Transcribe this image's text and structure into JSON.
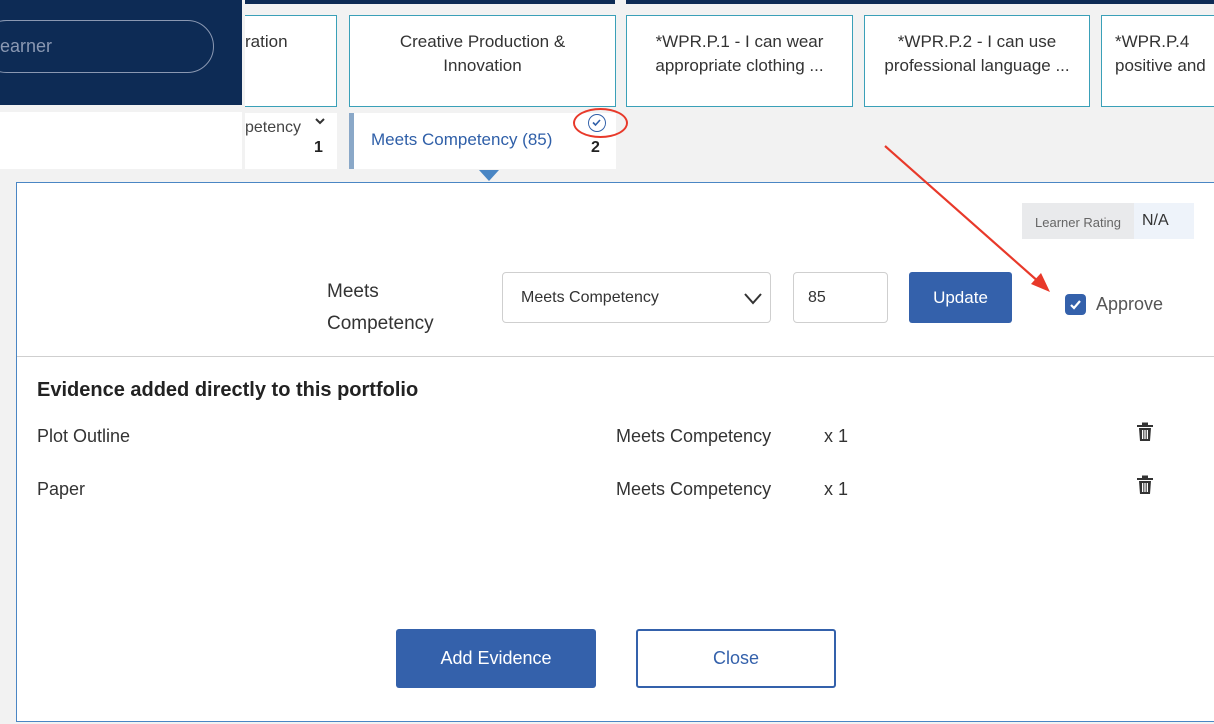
{
  "search": {
    "placeholder_fragment": "earner"
  },
  "competency_headers": [
    {
      "label_line1": "ration",
      "label_line2": ""
    },
    {
      "label_line1": "Creative Production &",
      "label_line2": "Innovation"
    },
    {
      "label_line1": "*WPR.P.1 - I can wear",
      "label_line2": "appropriate clothing ..."
    },
    {
      "label_line1": "*WPR.P.2 - I can use",
      "label_line2": "professional language ..."
    },
    {
      "label_line1": "*WPR.P.4",
      "label_line2": "positive and"
    }
  ],
  "strips": {
    "left": {
      "text": "petency",
      "count": "1",
      "chevron_icon": "chevron-down-icon"
    },
    "active": {
      "text": "Meets Competency (85)",
      "count": "2",
      "status_icon": "check-circle-icon"
    }
  },
  "panel": {
    "learner_rating": {
      "label": "Learner Rating",
      "value": "N/A"
    },
    "rating_label": "Meets Competency",
    "rating_select": {
      "value": "Meets Competency"
    },
    "score_input": {
      "value": "85"
    },
    "update_label": "Update",
    "approve": {
      "label": "Approve",
      "checked": true
    },
    "evidence_heading": "Evidence added directly to this portfolio",
    "evidence": [
      {
        "name": "Plot Outline",
        "rating": "Meets Competency",
        "count": "x 1"
      },
      {
        "name": "Paper",
        "rating": "Meets Competency",
        "count": "x 1"
      }
    ],
    "add_evidence_label": "Add Evidence",
    "close_label": "Close"
  },
  "colors": {
    "navy": "#0d2b55",
    "primary": "#3461ab",
    "card_border": "#3aa0b8",
    "annotation": "#e8392a"
  }
}
